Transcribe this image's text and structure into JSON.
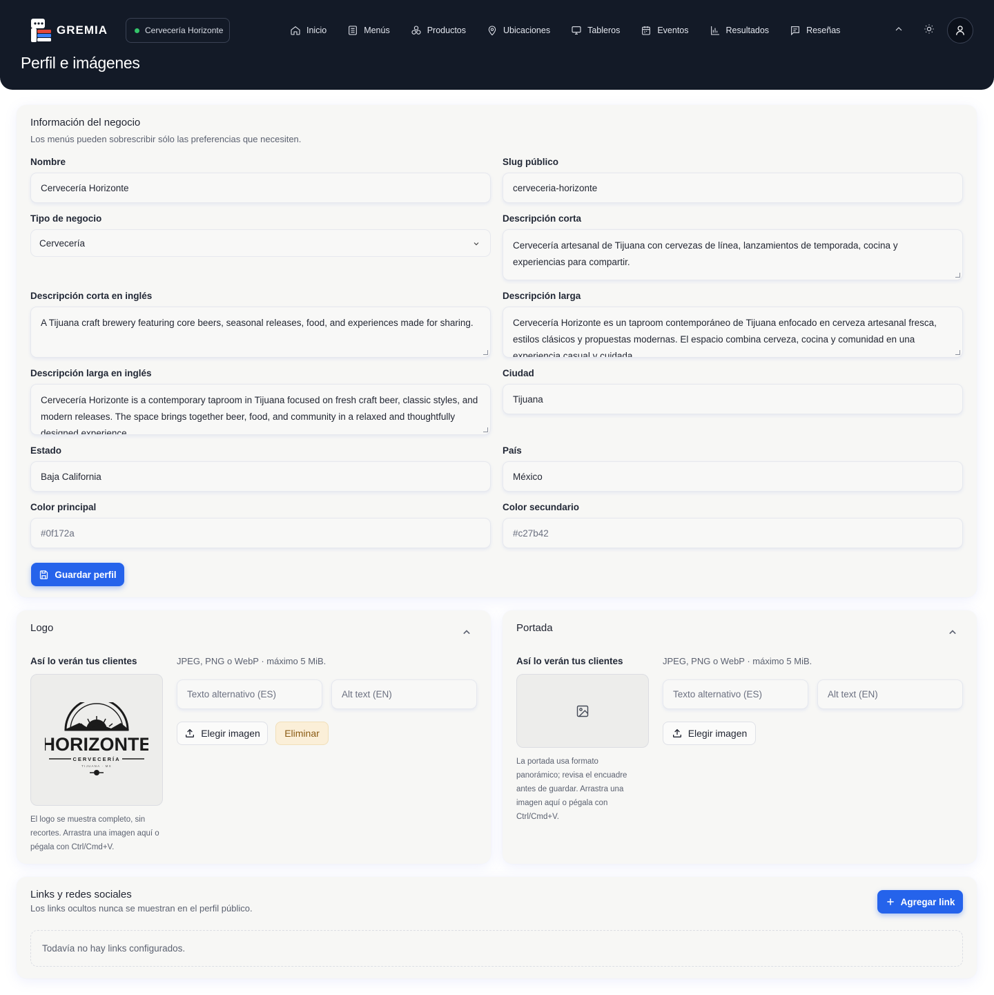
{
  "header": {
    "brand": "GREMIA",
    "business": "Cervecería Horizonte",
    "title": "Perfil e imágenes",
    "nav": [
      {
        "label": "Inicio",
        "icon": "home-icon"
      },
      {
        "label": "Menús",
        "icon": "menu-list-icon"
      },
      {
        "label": "Productos",
        "icon": "products-icon"
      },
      {
        "label": "Ubicaciones",
        "icon": "location-pin-icon"
      },
      {
        "label": "Tableros",
        "icon": "monitor-icon"
      },
      {
        "label": "Eventos",
        "icon": "calendar-icon"
      },
      {
        "label": "Resultados",
        "icon": "bar-chart-icon"
      },
      {
        "label": "Reseñas",
        "icon": "review-icon"
      }
    ]
  },
  "info": {
    "title": "Información del negocio",
    "subtitle": "Los menús pueden sobrescribir sólo las preferencias que necesiten.",
    "name_label": "Nombre",
    "name_value": "Cervecería Horizonte",
    "slug_label": "Slug público",
    "slug_value": "cerveceria-horizonte",
    "type_label": "Tipo de negocio",
    "type_value": "Cervecería",
    "short_label": "Descripción corta",
    "short_value": "Cervecería artesanal de Tijuana con cervezas de línea, lanzamientos de temporada, cocina y experiencias para compartir.",
    "short_en_label": "Descripción corta en inglés",
    "short_en_value": "A Tijuana craft brewery featuring core beers, seasonal releases, food, and experiences made for sharing.",
    "long_label": "Descripción larga",
    "long_value": "Cervecería Horizonte es un taproom contemporáneo de Tijuana enfocado en cerveza artesanal fresca, estilos clásicos y propuestas modernas. El espacio combina cerveza, cocina y comunidad en una experiencia casual y cuidada.",
    "long_en_label": "Descripción larga en inglés",
    "long_en_value": "Cervecería Horizonte is a contemporary taproom in Tijuana focused on fresh craft beer, classic styles, and modern releases. The space brings together beer, food, and community in a relaxed and thoughtfully designed experience.",
    "city_label": "Ciudad",
    "city_value": "Tijuana",
    "state_label": "Estado",
    "state_value": "Baja California",
    "country_label": "País",
    "country_value": "México",
    "primary_label": "Color principal",
    "primary_placeholder": "#0f172a",
    "secondary_label": "Color secundario",
    "secondary_placeholder": "#c27b42",
    "save_label": "Guardar perfil"
  },
  "logo": {
    "title": "Logo",
    "preview_label": "Así lo verán tus clientes",
    "formats": "JPEG, PNG o WebP · máximo 5 MiB.",
    "alt_es_placeholder": "Texto alternativo (ES)",
    "alt_en_placeholder": "Alt text (EN)",
    "choose_label": "Elegir imagen",
    "remove_label": "Eliminar",
    "hint": "El logo se muestra completo, sin recortes. Arrastra una imagen aquí o pégala con Ctrl/Cmd+V.",
    "logo_word": "HORIZONTE",
    "logo_sub": "CERVECERÍA",
    "logo_city": "TIJUANA · MX"
  },
  "cover": {
    "title": "Portada",
    "preview_label": "Así lo verán tus clientes",
    "formats": "JPEG, PNG o WebP · máximo 5 MiB.",
    "alt_es_placeholder": "Texto alternativo (ES)",
    "alt_en_placeholder": "Alt text (EN)",
    "choose_label": "Elegir imagen",
    "hint": "La portada usa formato panorámico; revisa el encuadre antes de guardar. Arrastra una imagen aquí o pégala con Ctrl/Cmd+V."
  },
  "links": {
    "title": "Links y redes sociales",
    "subtitle": "Los links ocultos nunca se muestran en el perfil público.",
    "add_label": "Agregar link",
    "empty": "Todavía no hay links configurados."
  },
  "colors": {
    "header_bg": "#131a27",
    "accent": "#2563eb",
    "card_bg": "#f7f7f5",
    "warn_bg": "#fbefd8"
  }
}
